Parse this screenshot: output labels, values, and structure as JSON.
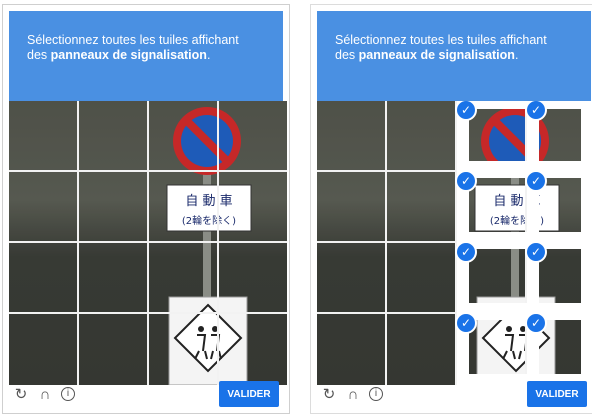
{
  "colors": {
    "header_bg": "#4a90e2",
    "button_bg": "#1a73e8",
    "check_bg": "#1a73e8"
  },
  "left": {
    "prompt_line1": "Sélectionnez toutes les tuiles affichant",
    "prompt_prefix": "des",
    "prompt_bold": "panneaux de signalisation",
    "prompt_suffix": ".",
    "sign_text_top": "自 動 車",
    "sign_text_bottom": "(2輪を除く)",
    "verify_label": "VALIDER",
    "footer_icons": [
      "reload-icon",
      "audio-icon",
      "info-icon"
    ]
  },
  "right": {
    "prompt_line1": "Sélectionnez toutes les tuiles affichant",
    "prompt_prefix": "des",
    "prompt_bold": "panneaux de signalisation",
    "prompt_suffix": ".",
    "sign_text_top": "自 動 車",
    "sign_text_bottom": "(2輪を除く)",
    "verify_label": "VALIDER",
    "footer_icons": [
      "reload-icon",
      "audio-icon",
      "info-icon"
    ]
  }
}
